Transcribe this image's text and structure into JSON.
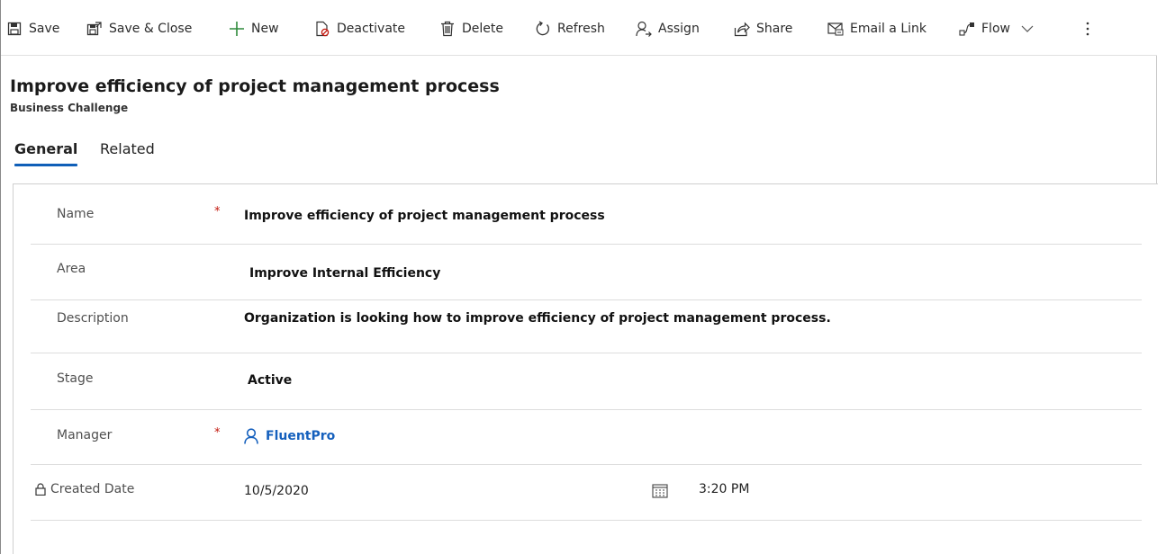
{
  "commands": {
    "save": "Save",
    "save_close": "Save & Close",
    "new": "New",
    "deactivate": "Deactivate",
    "delete": "Delete",
    "refresh": "Refresh",
    "assign": "Assign",
    "share": "Share",
    "email_link": "Email a Link",
    "flow": "Flow"
  },
  "record": {
    "title": "Improve efficiency of project management process",
    "entity": "Business Challenge"
  },
  "tabs": [
    "General",
    "Related"
  ],
  "fields": {
    "name": {
      "label": "Name",
      "value": "Improve efficiency of project management process",
      "required": "*"
    },
    "area": {
      "label": "Area",
      "value": "Improve Internal Efficiency"
    },
    "description": {
      "label": "Description",
      "value": "Organization is looking how to improve efficiency of project management process."
    },
    "stage": {
      "label": "Stage",
      "value": "Active"
    },
    "manager": {
      "label": "Manager",
      "value": "FluentPro",
      "required": "*"
    },
    "created": {
      "label": "Created Date",
      "date": "10/5/2020",
      "time": "3:20 PM"
    }
  },
  "colors": {
    "accent": "#0f5fb8",
    "link": "#1560bd",
    "required": "#c2170d"
  }
}
